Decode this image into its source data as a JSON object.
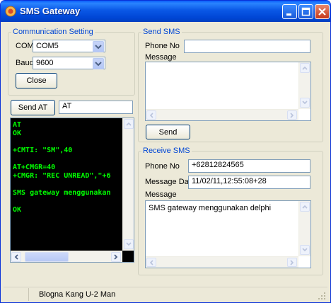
{
  "window": {
    "title": "SMS Gateway"
  },
  "comm": {
    "legend": "Communication Setting",
    "com_label": "COM",
    "com_value": "COM5",
    "baud_label": "Baud",
    "baud_value": "9600",
    "close_label": "Close"
  },
  "at": {
    "send_label": "Send AT",
    "value": "AT"
  },
  "terminal": {
    "lines": [
      "AT",
      "OK",
      "",
      "+CMTI: \"SM\",40",
      "",
      "AT+CMGR=40",
      "+CMGR: \"REC UNREAD\",\"+6",
      "",
      "SMS gateway menggunakan",
      "",
      "OK"
    ]
  },
  "send_sms": {
    "legend": "Send SMS",
    "phone_label": "Phone No",
    "phone_value": "",
    "message_label": "Message",
    "message_value": "",
    "send_label": "Send"
  },
  "receive_sms": {
    "legend": "Receive SMS",
    "phone_label": "Phone No",
    "phone_value": "+62812824565",
    "date_label": "Message Date",
    "date_value": "11/02/11,12:55:08+28",
    "message_label": "Message",
    "message_value": "SMS gateway menggunakan delphi"
  },
  "status": {
    "text": "Blogna Kang U-2 Man"
  },
  "colors": {
    "title_bar": "#0a58e6",
    "terminal_bg": "#000000",
    "terminal_text": "#00ff00",
    "legend_text": "#0046d5"
  }
}
